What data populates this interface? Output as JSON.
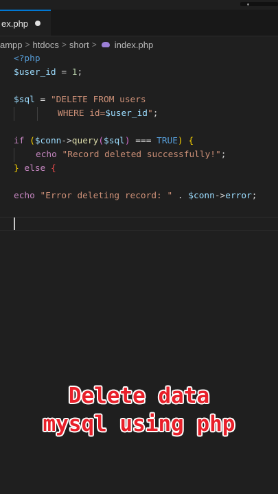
{
  "tab": {
    "label": "ex.php"
  },
  "breadcrumb": {
    "items": [
      "ampp",
      "htdocs",
      "short",
      "index.php"
    ]
  },
  "code": {
    "l1": "<?php",
    "l2_var": "$user_id",
    "l2_eq": " = ",
    "l2_num": "1",
    "l2_end": ";",
    "l4_var": "$sql",
    "l4_eq": " = ",
    "l4_str": "\"DELETE FROM users",
    "l5_str_a": "WHERE id=",
    "l5_var": "$user_id",
    "l5_str_b": "\"",
    "l5_end": ";",
    "l7_if": "if",
    "l7_p1": " (",
    "l7_conn": "$conn",
    "l7_arrow": "->",
    "l7_query": "query",
    "l7_p2": "(",
    "l7_sql": "$sql",
    "l7_p3": ")",
    "l7_cmp": " === ",
    "l7_true": "TRUE",
    "l7_p4": ")",
    "l7_brace": " {",
    "l8_echo": "echo",
    "l8_str": "\"Record deleted successfully!\"",
    "l8_end": ";",
    "l9_close": "}",
    "l9_else": " else ",
    "l9_brace": "{",
    "l11_echo": "echo",
    "l11_str": "\"Error deleting record: \"",
    "l11_dot": " . ",
    "l11_conn": "$conn",
    "l11_arrow": "->",
    "l11_error": "error",
    "l11_end": ";"
  },
  "caption": {
    "line1": "Delete data",
    "line2": "mysql using php"
  },
  "colors": {
    "accent": "#0078d4",
    "caption": "#e8202a",
    "background": "#1f1f1f"
  }
}
